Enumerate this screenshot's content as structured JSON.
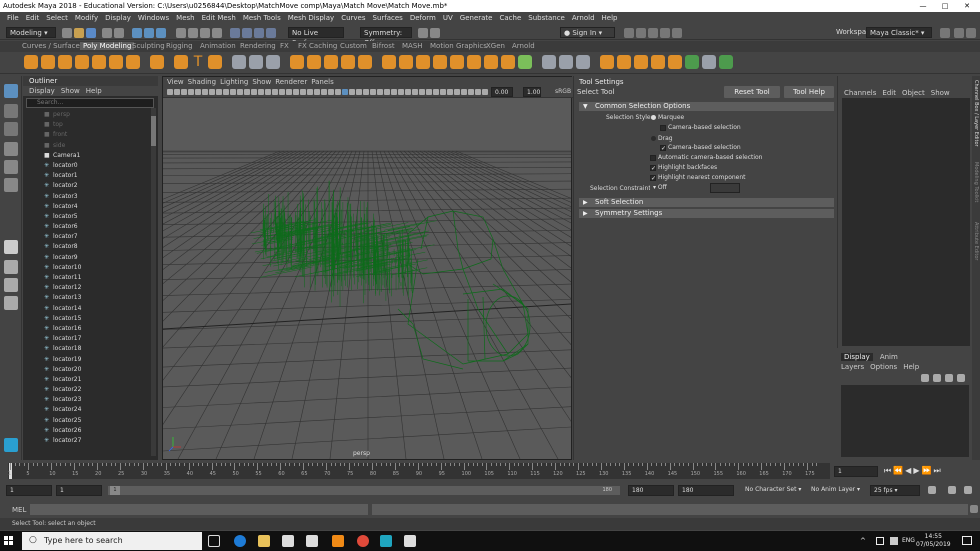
{
  "window": {
    "title": "Autodesk Maya 2018 - Educational Version: C:\\Users\\u0256844\\Desktop\\MatchMove comp\\Maya\\Match Move\\Match Move.mb*",
    "controls": [
      "—",
      "□",
      "✕"
    ]
  },
  "menubar": [
    "File",
    "Edit",
    "Select",
    "Modify",
    "Display",
    "Windows",
    "Mesh",
    "Edit Mesh",
    "Mesh Tools",
    "Mesh Display",
    "Curves",
    "Surfaces",
    "Deform",
    "UV",
    "Generate",
    "Cache",
    "Substance",
    "Arnold",
    "Help"
  ],
  "workspace": {
    "label": "Workspace :",
    "value": "Maya Classic*"
  },
  "statusline": {
    "menuset": "Modeling",
    "live_surface": "No Live Surface",
    "symmetry": "Symmetry: Off",
    "sign_in": "Sign In"
  },
  "shelf_tabs": [
    "Curves / Surfaces",
    "Poly Modeling",
    "Sculpting",
    "Rigging",
    "Animation",
    "Rendering",
    "FX",
    "FX Caching",
    "Custom",
    "Bifrost",
    "MASH",
    "Motion Graphics",
    "XGen",
    "Arnold"
  ],
  "shelf_active": "Poly Modeling",
  "outliner": {
    "title": "Outliner",
    "menus": [
      "Display",
      "Show",
      "Help"
    ],
    "search_placeholder": "Search...",
    "items": [
      {
        "name": "persp",
        "dim": true,
        "icon": "camera-icon"
      },
      {
        "name": "top",
        "dim": true,
        "icon": "camera-icon"
      },
      {
        "name": "front",
        "dim": true,
        "icon": "camera-icon"
      },
      {
        "name": "side",
        "dim": true,
        "icon": "camera-icon"
      },
      {
        "name": "Camera1",
        "dim": false,
        "icon": "camera-icon"
      },
      {
        "name": "locator0",
        "dim": false,
        "icon": "locator-icon"
      },
      {
        "name": "locator1",
        "dim": false,
        "icon": "locator-icon"
      },
      {
        "name": "locator2",
        "dim": false,
        "icon": "locator-icon"
      },
      {
        "name": "locator3",
        "dim": false,
        "icon": "locator-icon"
      },
      {
        "name": "locator4",
        "dim": false,
        "icon": "locator-icon"
      },
      {
        "name": "locator5",
        "dim": false,
        "icon": "locator-icon"
      },
      {
        "name": "locator6",
        "dim": false,
        "icon": "locator-icon"
      },
      {
        "name": "locator7",
        "dim": false,
        "icon": "locator-icon"
      },
      {
        "name": "locator8",
        "dim": false,
        "icon": "locator-icon"
      },
      {
        "name": "locator9",
        "dim": false,
        "icon": "locator-icon"
      },
      {
        "name": "locator10",
        "dim": false,
        "icon": "locator-icon"
      },
      {
        "name": "locator11",
        "dim": false,
        "icon": "locator-icon"
      },
      {
        "name": "locator12",
        "dim": false,
        "icon": "locator-icon"
      },
      {
        "name": "locator13",
        "dim": false,
        "icon": "locator-icon"
      },
      {
        "name": "locator14",
        "dim": false,
        "icon": "locator-icon"
      },
      {
        "name": "locator15",
        "dim": false,
        "icon": "locator-icon"
      },
      {
        "name": "locator16",
        "dim": false,
        "icon": "locator-icon"
      },
      {
        "name": "locator17",
        "dim": false,
        "icon": "locator-icon"
      },
      {
        "name": "locator18",
        "dim": false,
        "icon": "locator-icon"
      },
      {
        "name": "locator19",
        "dim": false,
        "icon": "locator-icon"
      },
      {
        "name": "locator20",
        "dim": false,
        "icon": "locator-icon"
      },
      {
        "name": "locator21",
        "dim": false,
        "icon": "locator-icon"
      },
      {
        "name": "locator22",
        "dim": false,
        "icon": "locator-icon"
      },
      {
        "name": "locator23",
        "dim": false,
        "icon": "locator-icon"
      },
      {
        "name": "locator24",
        "dim": false,
        "icon": "locator-icon"
      },
      {
        "name": "locator25",
        "dim": false,
        "icon": "locator-icon"
      },
      {
        "name": "locator26",
        "dim": false,
        "icon": "locator-icon"
      },
      {
        "name": "locator27",
        "dim": false,
        "icon": "locator-icon"
      }
    ]
  },
  "viewport": {
    "menus": [
      "View",
      "Shading",
      "Lighting",
      "Show",
      "Renderer",
      "Panels"
    ],
    "camera_label": "persp",
    "field_a": "0.00",
    "field_b": "1.00",
    "colorspace": "sRGB",
    "wire_color": "#0d6b1a"
  },
  "tool_settings": {
    "title": "Tool Settings",
    "tool_name": "Select Tool",
    "reset_button": "Reset Tool",
    "help_button": "Tool Help",
    "frame_common": "Common Selection Options",
    "selection_style_label": "Selection Style:",
    "marquee": "Marquee",
    "camera_based_1": "Camera-based selection",
    "drag": "Drag",
    "camera_based_2": "Camera-based selection",
    "auto_camera": "Automatic camera-based selection",
    "backfaces": "Highlight backfaces",
    "nearest": "Highlight nearest component",
    "constraint_label": "Selection Constraint:",
    "constraint_value": "Off",
    "frame_soft": "Soft Selection",
    "frame_symmetry": "Symmetry Settings"
  },
  "channel_box": {
    "menus": [
      "Channels",
      "Edit",
      "Object",
      "Show"
    ]
  },
  "layers": {
    "tabs": [
      "Display",
      "Anim"
    ],
    "menus": [
      "Layers",
      "Options",
      "Help"
    ]
  },
  "right_strip": [
    "Channel Box / Layer Editor",
    "Modeling Toolkit",
    "Attribute Editor"
  ],
  "time_slider": {
    "ticks": [
      "1",
      "5",
      "10",
      "15",
      "20",
      "25",
      "30",
      "35",
      "40",
      "45",
      "50",
      "55",
      "60",
      "65",
      "70",
      "75",
      "80",
      "85",
      "90",
      "95",
      "100",
      "105",
      "110",
      "115",
      "120",
      "125",
      "130",
      "135",
      "140",
      "145",
      "150",
      "155",
      "160",
      "165",
      "170",
      "175"
    ],
    "current_frame": "1"
  },
  "range_slider": {
    "start": "1",
    "start_inner": "1",
    "range_box_label": "1",
    "end_inner": "180",
    "end": "180",
    "end_outer": "180",
    "character_set": "No Character Set",
    "anim_layer": "No Anim Layer",
    "fps": "25 fps"
  },
  "command_line": {
    "label": "MEL"
  },
  "help_line": "Select Tool: select an object",
  "taskbar": {
    "search_placeholder": "Type here to search",
    "lang": "ENG",
    "time": "14:55",
    "date": "07/05/2019"
  }
}
